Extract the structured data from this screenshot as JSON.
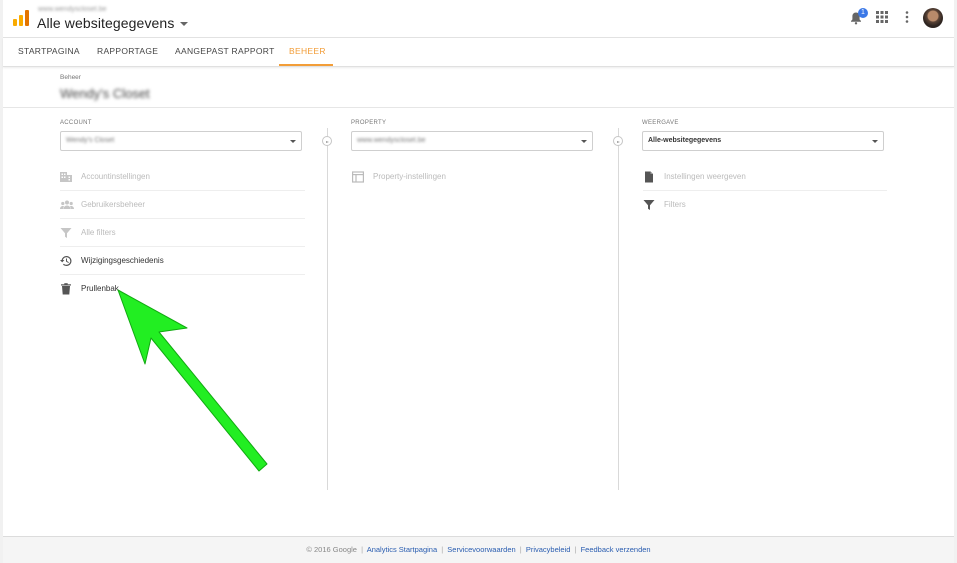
{
  "header": {
    "site_url": "www.wendyscloset.be",
    "title": "Alle websitegegevens",
    "notification_count": "1"
  },
  "tabs": [
    {
      "label": "STARTPAGINA"
    },
    {
      "label": "RAPPORTAGE"
    },
    {
      "label": "AANGEPAST RAPPORT"
    },
    {
      "label": "BEHEER"
    }
  ],
  "admin": {
    "breadcrumb": "Beheer",
    "account_name": "Wendy's Closet"
  },
  "account": {
    "label": "ACCOUNT",
    "selected": "Wendy's Closet",
    "items": [
      {
        "label": "Accountinstellingen",
        "icon": "building-icon"
      },
      {
        "label": "Gebruikersbeheer",
        "icon": "people-icon"
      },
      {
        "label": "Alle filters",
        "icon": "filter-icon"
      },
      {
        "label": "Wijzigingsgeschiedenis",
        "icon": "history-icon"
      },
      {
        "label": "Prullenbak",
        "icon": "trash-icon"
      }
    ]
  },
  "property": {
    "label": "PROPERTY",
    "selected": "www.wendyscloset.be",
    "items": [
      {
        "label": "Property-instellingen",
        "icon": "window-icon"
      }
    ]
  },
  "view": {
    "label": "WEERGAVE",
    "selected": "Alle-websitegegevens",
    "items": [
      {
        "label": "Instellingen weergeven",
        "icon": "document-icon"
      },
      {
        "label": "Filters",
        "icon": "filter-icon"
      }
    ]
  },
  "footer": {
    "copyright": "© 2016 Google",
    "links": [
      "Analytics Startpagina",
      "Servicevoorwaarden",
      "Privacybeleid",
      "Feedback verzenden"
    ],
    "separator": "|"
  },
  "colors": {
    "accent": "#f29d38",
    "link": "#2a5db0",
    "annotation_arrow": "#22ee22",
    "badge": "#3b78e7"
  }
}
